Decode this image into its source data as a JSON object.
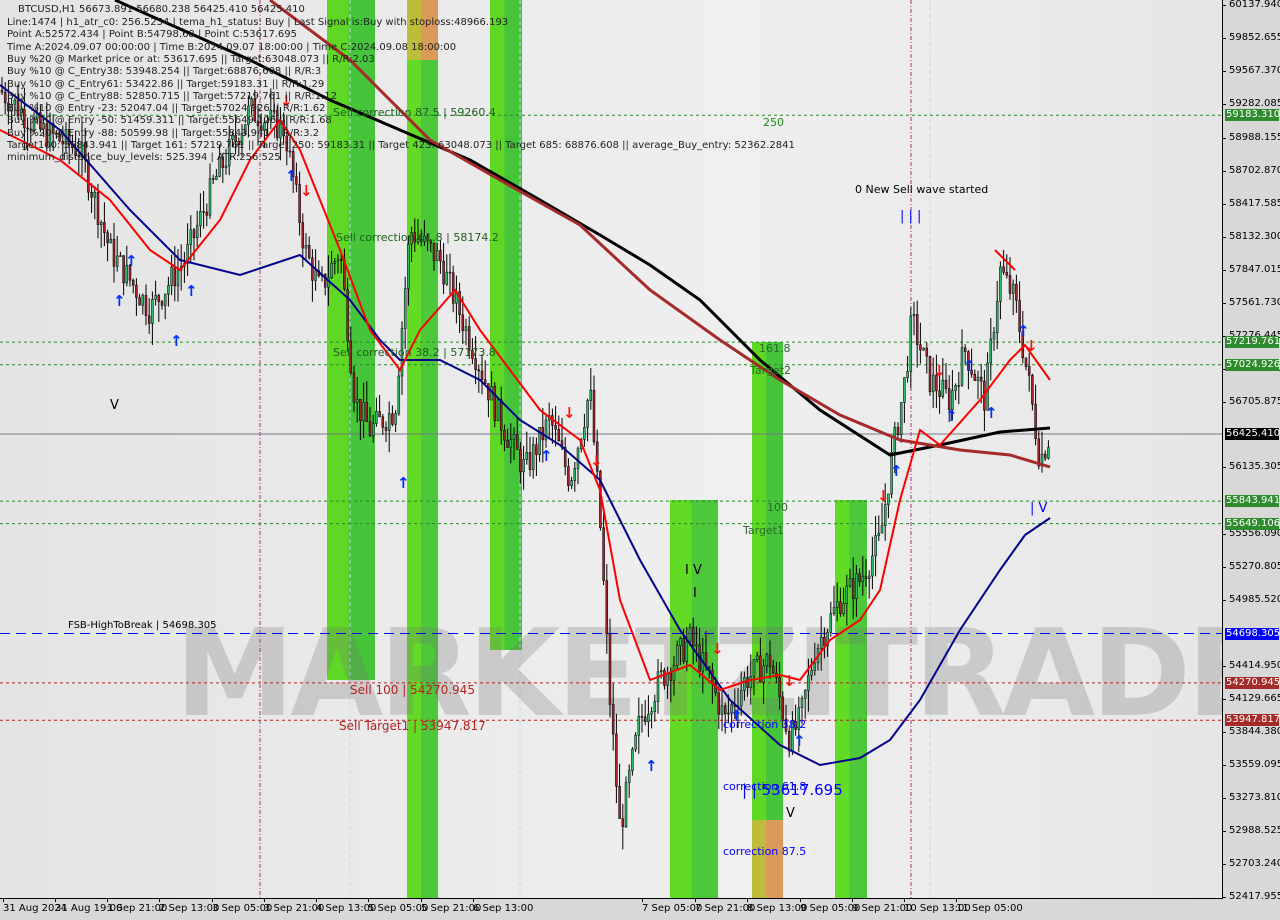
{
  "header": {
    "title": "BTCUSD,H1  56673.891 56680.238 56425.410 56425.410",
    "lines": [
      "Line:1474 | h1_atr_c0: 256.5254 | tema_h1_status: Buy | Last Signal is:Buy with stoploss:48966.193",
      "Point A:52572.434 | Point B:54798.68 | Point C:53617.695",
      "Time A:2024.09.07 00:00:00 | Time B:2024.09.07 18:00:00 | Time C:2024.09.08 18:00:00",
      "Buy %20 @ Market price or at: 53617.695 || Target:63048.073 || R/R:2.03",
      "Buy %10 @ C_Entry38: 53948.254 || Target:68876.608 || R/R:3",
      "Buy %10 @ C_Entry61: 53422.86 || Target:59183.31 || R/R:1.29",
      "Buy %10 @ C_Entry88: 52850.715 || Target:57219.761 || R/R:1.12",
      "Buy %10 @ Entry -23: 52047.04 || Target:57024.926 || R/R:1.62",
      "Buy %20 @ Entry -50: 51459.311 || Target:55649.106 || R/R:1.68",
      "Buy %20 @ Entry -88: 50599.98 || Target:55843.941 || R/R:3.2",
      "Target100: 55843.941 || Target 161: 57219.761 || Target 250: 59183.31 || Target 423: 63048.073 || Target 685: 68876.608 || average_Buy_entry: 52362.2841",
      "minimum_distance_buy_levels: 525.394 | ATR:256.525"
    ]
  },
  "annotations": {
    "sell_corr_875": "Sell correction 87.5 | 59260.4",
    "sell_corr_618": "Sell correction 61.8 | 58174.2",
    "sell_corr_382": "Sell correction 38.2 | 57173.8",
    "l250": "250",
    "new_wave": "0 New Sell wave started",
    "l1618": "161.8",
    "target2": "Target2",
    "l100": "100",
    "target1": "Target1",
    "fsb": "FSB-HighToBreak | 54698.305",
    "sell100": "Sell 100 | 54270.945",
    "sell_target1": "Sell Target1 | 53947.817",
    "corr382": "correction 38.2",
    "corr618": "correction 61.8",
    "corr875": "correction 87.5",
    "point_c": "| | 53617.695",
    "wave_top": "| | |",
    "wave_v": "| V",
    "wave_i": "I",
    "v1": "V",
    "v2": "V",
    "v3": "V",
    "bar1": "I V",
    "point_b": "I",
    "watermark": "MARKETZITRADE"
  },
  "colors": {
    "bull": "#2fb86a",
    "bear": "#a0222a",
    "ma_black": "#000000",
    "ma_brown": "#a52a2a",
    "ma_blue": "#00008b",
    "ma_red": "#ff0000",
    "green_level": "#228b22",
    "red_level": "#b22222",
    "blue_level": "#0000ff"
  },
  "chart_data": {
    "type": "candlestick",
    "symbol": "BTCUSD",
    "timeframe": "H1",
    "ylim": [
      52417.955,
      60137.94
    ],
    "grid": false,
    "y_ticks": [
      60137.94,
      59852.655,
      59567.37,
      59282.085,
      58988.155,
      58702.87,
      58417.585,
      58132.3,
      57847.015,
      57561.73,
      57276.445,
      56991.16,
      56705.875,
      56135.305,
      55556.09,
      55270.805,
      54985.52,
      54414.95,
      54129.665,
      53844.38,
      53559.095,
      53273.81,
      52988.525,
      52703.24,
      52417.955
    ],
    "x_ticks": [
      "31 Aug 2024",
      "31 Aug 19:00",
      "1 Sep 21:00",
      "2 Sep 13:00",
      "3 Sep 05:00",
      "3 Sep 21:00",
      "4 Sep 13:00",
      "5 Sep 05:00",
      "5 Sep 21:00",
      "6 Sep 13:00",
      "7 Sep 05:00",
      "7 Sep 21:00",
      "8 Sep 13:00",
      "9 Sep 05:00",
      "9 Sep 21:00",
      "10 Sep 13:00",
      "11 Sep 05:00"
    ],
    "approx_closes": [
      59402,
      59056,
      58883,
      58018,
      57499,
      57931,
      58624,
      59229,
      59056,
      58018,
      57672,
      58018,
      56720,
      56460,
      56633,
      58191,
      57931,
      57585,
      57239,
      56547,
      56114,
      56547,
      56027,
      56806,
      55681,
      54123,
      52998,
      53950,
      54297,
      54643,
      54297,
      53950,
      54297,
      54470,
      53777,
      53950,
      54556,
      54989,
      55162,
      55508,
      56114,
      56893,
      57412,
      56893,
      56720,
      57152,
      56720,
      57845,
      57585,
      56806,
      56200,
      56425.41
    ],
    "last_price": 56425.41,
    "levels": [
      {
        "price": 59183.31,
        "kind": "green"
      },
      {
        "price": 57219.761,
        "kind": "green"
      },
      {
        "price": 57024.926,
        "kind": "green"
      },
      {
        "price": 55843.941,
        "kind": "green"
      },
      {
        "price": 55649.106,
        "kind": "green"
      },
      {
        "price": 54698.305,
        "kind": "blue"
      },
      {
        "price": 54270.945,
        "kind": "red"
      },
      {
        "price": 53947.817,
        "kind": "red"
      }
    ],
    "level_labels": [
      "59183.310",
      "57219.761",
      "57024.926",
      "55843.941",
      "55649.106",
      "54698.305",
      "54270.945",
      "53947.817"
    ],
    "last_label": "56425.410"
  }
}
